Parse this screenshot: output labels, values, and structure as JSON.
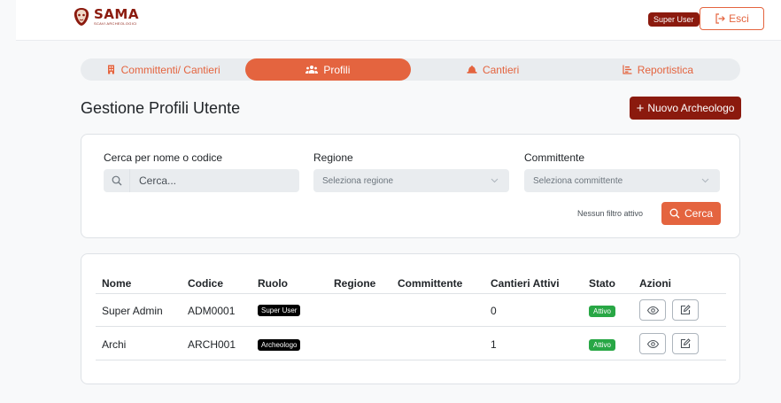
{
  "header": {
    "logo_name": "SAMA",
    "logo_sub": "SCAVI ARCHEOLOGICI",
    "role_badge": "Super User",
    "logout_label": "Esci"
  },
  "tabs": [
    {
      "label": "Committenti/ Cantieri",
      "icon": "building-icon",
      "active": false
    },
    {
      "label": "Profili",
      "icon": "users-icon",
      "active": true
    },
    {
      "label": "Cantieri",
      "icon": "hardhat-icon",
      "active": false
    },
    {
      "label": "Reportistica",
      "icon": "chart-icon",
      "active": false
    }
  ],
  "page": {
    "title": "Gestione Profili Utente",
    "new_button": "Nuovo Archeologo"
  },
  "filters": {
    "search_label": "Cerca per nome o codice",
    "search_placeholder": "Cerca...",
    "region_label": "Regione",
    "region_placeholder": "Seleziona regione",
    "client_label": "Committente",
    "client_placeholder": "Seleziona committente",
    "status_text": "Nessun filtro attivo",
    "search_button": "Cerca"
  },
  "table": {
    "headers": [
      "Nome",
      "Codice",
      "Ruolo",
      "Regione",
      "Committente",
      "Cantieri Attivi",
      "Stato",
      "Azioni"
    ],
    "rows": [
      {
        "nome": "Super Admin",
        "codice": "ADM0001",
        "ruolo": "Super User",
        "regione": "",
        "committente": "",
        "cantieri": "0",
        "stato": "Attivo"
      },
      {
        "nome": "Archi",
        "codice": "ARCH001",
        "ruolo": "Archeologo",
        "regione": "",
        "committente": "",
        "cantieri": "1",
        "stato": "Attivo"
      }
    ]
  },
  "colors": {
    "brand_dark": "#8b1a0e",
    "accent": "#e4643f",
    "success": "#28a745"
  }
}
